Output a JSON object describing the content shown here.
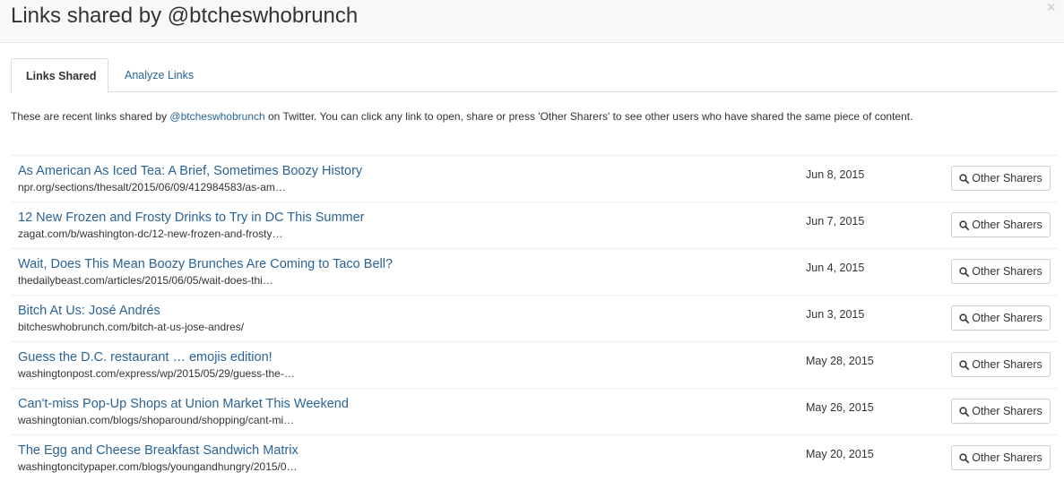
{
  "modal": {
    "title": "Links shared by @btcheswhobrunch",
    "close_glyph": "×"
  },
  "tabs": [
    {
      "label": "Links Shared",
      "active": true
    },
    {
      "label": "Analyze Links",
      "active": false
    }
  ],
  "intro": {
    "before": "These are recent links shared by ",
    "user": "@btcheswhobrunch",
    "after": " on Twitter. You can click any link to open, share or press 'Other Sharers' to see other users who have shared the same piece of content."
  },
  "links": [
    {
      "title": "As American As Iced Tea: A Brief, Sometimes Boozy History",
      "url": "npr.org/sections/thesalt/2015/06/09/412984583/as-am…",
      "date": "Jun 8, 2015",
      "button": "Other Sharers"
    },
    {
      "title": "12 New Frozen and Frosty Drinks to Try in DC This Summer",
      "url": "zagat.com/b/washington-dc/12-new-frozen-and-frosty…",
      "date": "Jun 7, 2015",
      "button": "Other Sharers"
    },
    {
      "title": "Wait, Does This Mean Boozy Brunches Are Coming to Taco Bell?",
      "url": "thedailybeast.com/articles/2015/06/05/wait-does-thi…",
      "date": "Jun 4, 2015",
      "button": "Other Sharers"
    },
    {
      "title": "Bitch At Us: José Andrés",
      "url": "bitcheswhobrunch.com/bitch-at-us-jose-andres/",
      "date": "Jun 3, 2015",
      "button": "Other Sharers"
    },
    {
      "title": "Guess the D.C. restaurant … emojis edition!",
      "url": "washingtonpost.com/express/wp/2015/05/29/guess-the-…",
      "date": "May 28, 2015",
      "button": "Other Sharers"
    },
    {
      "title": "Can't-miss Pop-Up Shops at Union Market This Weekend",
      "url": "washingtonian.com/blogs/shoparound/shopping/cant-mi…",
      "date": "May 26, 2015",
      "button": "Other Sharers"
    },
    {
      "title": "The Egg and Cheese Breakfast Sandwich Matrix",
      "url": "washingtoncitypaper.com/blogs/youngandhungry/2015/0…",
      "date": "May 20, 2015",
      "button": "Other Sharers"
    }
  ],
  "colors": {
    "link": "#2a6496",
    "header_bg": "#f8f8f8",
    "border": "#dddddd"
  },
  "icons": {
    "close": "close-icon",
    "search": "search-icon"
  }
}
